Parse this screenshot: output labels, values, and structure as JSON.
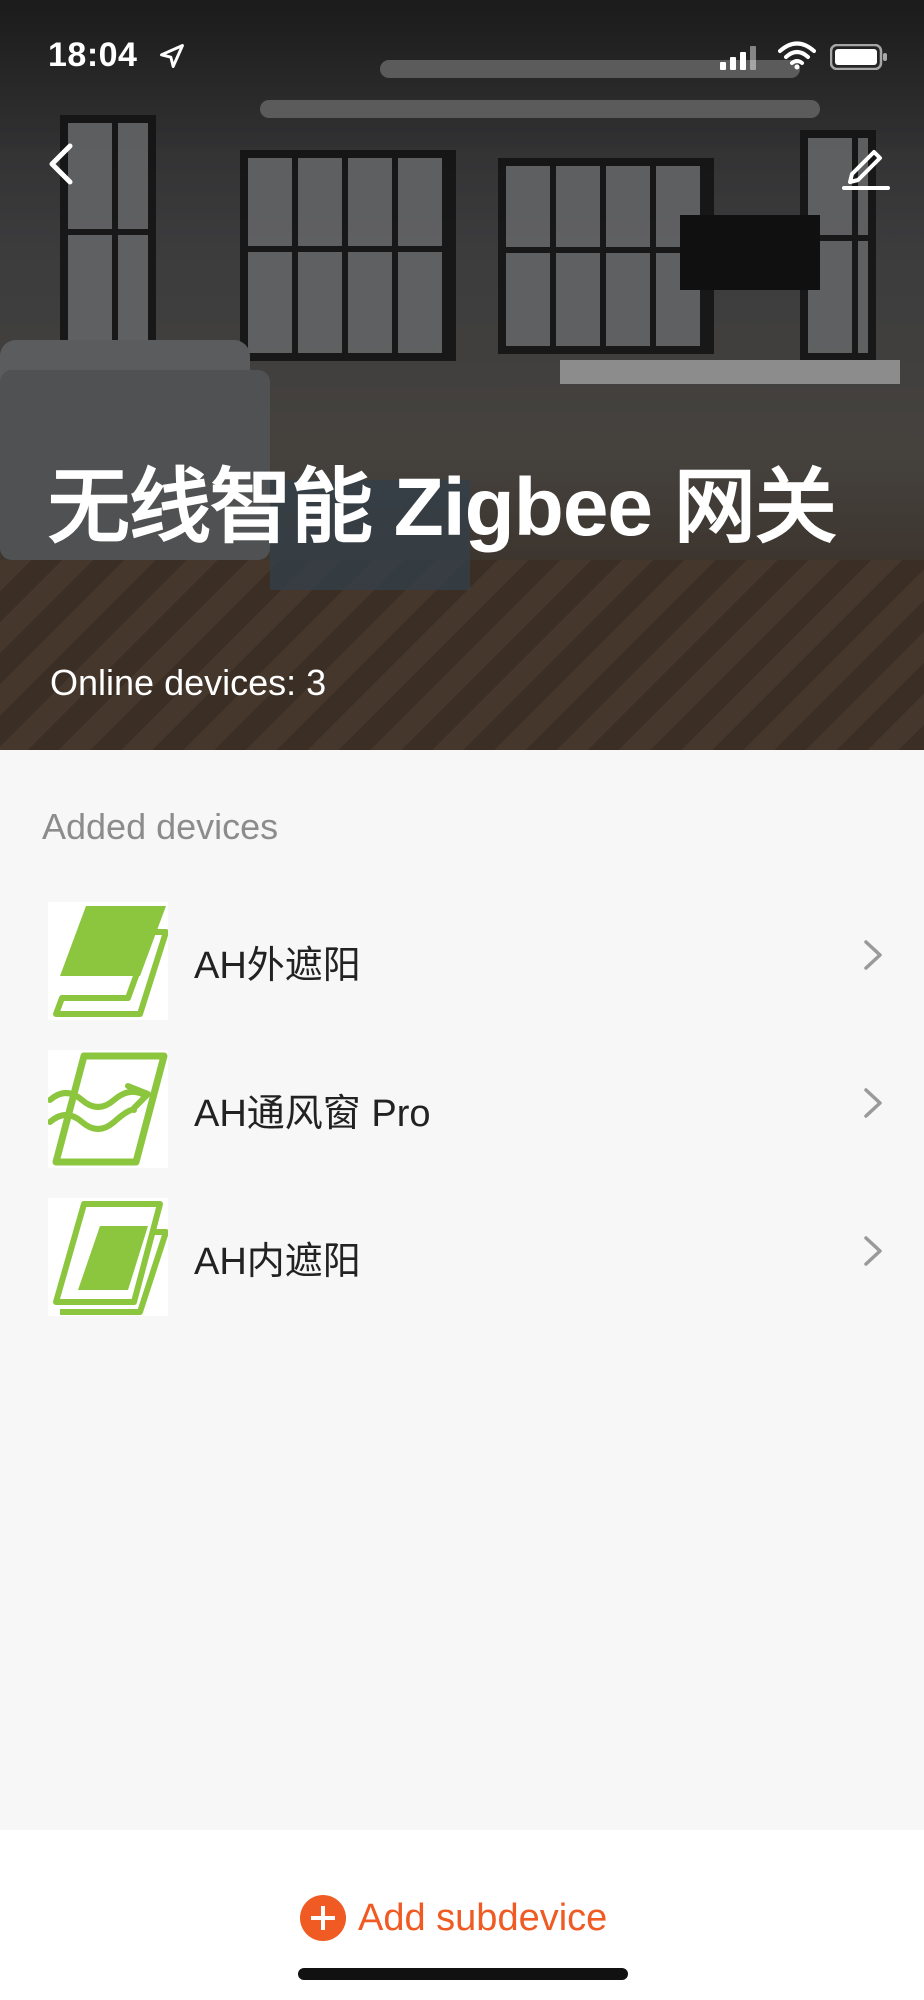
{
  "status_bar": {
    "time": "18:04"
  },
  "hero": {
    "title": "无线智能 Zigbee 网关",
    "online_devices": "Online devices: 3"
  },
  "section": {
    "label": "Added devices"
  },
  "devices": [
    {
      "label": "AH外遮阳",
      "icon": "exterior-shade-icon"
    },
    {
      "label": "AH通风窗 Pro",
      "icon": "ventilation-window-icon"
    },
    {
      "label": "AH内遮阳",
      "icon": "interior-shade-icon"
    }
  ],
  "footer": {
    "add_label": "Add subdevice"
  },
  "colors": {
    "accent": "#f05a23",
    "icon_green": "#8cc63f"
  }
}
